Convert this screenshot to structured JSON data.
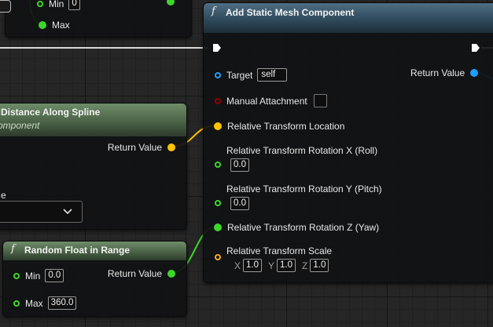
{
  "colors": {
    "exec": "#ffffff",
    "object_pin": "#1ea0ff",
    "vector_pin": "#ffc400",
    "float_pin": "#3cd629",
    "bool_pin": "#950000",
    "transform_pin": "#f5a623",
    "function_header": "#3d5a6c",
    "pure_header": "#5a7854"
  },
  "top_node": {
    "max_label": "Max",
    "min_label_partial": "Min",
    "min_value_partial": "0"
  },
  "spline_node": {
    "title": "Distance Along Spline",
    "subtitle": "omponent",
    "return_label": "Return Value",
    "param_label_partial": "e",
    "dropdown_icon": "chevron-down-icon"
  },
  "random_node": {
    "func_symbol": "f",
    "title": "Random Float in Range",
    "min_label": "Min",
    "min_value": "0.0",
    "max_label": "Max",
    "max_value": "360.0",
    "return_label": "Return Value"
  },
  "add_node": {
    "func_symbol": "f",
    "title": "Add Static Mesh Component",
    "target_label": "Target",
    "target_value": "self",
    "return_label": "Return Value",
    "manual_attachment_label": "Manual Attachment",
    "location_label": "Relative Transform Location",
    "rot_x_label": "Relative Transform Rotation X (Roll)",
    "rot_x_value": "0.0",
    "rot_y_label": "Relative Transform Rotation Y (Pitch)",
    "rot_y_value": "0.0",
    "rot_z_label": "Relative Transform Rotation Z (Yaw)",
    "scale_label": "Relative Transform Scale",
    "scale_x_label": "X",
    "scale_x_value": "1.0",
    "scale_y_label": "Y",
    "scale_y_value": "1.0",
    "scale_z_label": "Z",
    "scale_z_value": "1.0"
  }
}
